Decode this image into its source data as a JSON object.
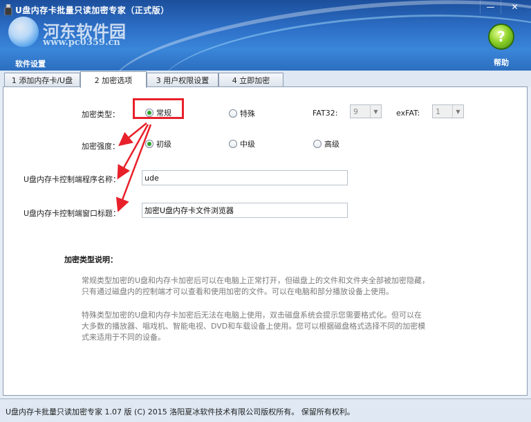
{
  "window": {
    "title": "U盘内存卡批量只读加密专家（正式版）",
    "minimize_glyph": "—",
    "close_glyph": "✕"
  },
  "watermark": {
    "text": "河东软件园",
    "url": "www.pc0359.cn"
  },
  "header": {
    "settings_label": "软件设置",
    "help_label": "帮助",
    "help_glyph": "?"
  },
  "tabs": [
    {
      "label": "1 添加内存卡/U盘"
    },
    {
      "label": "2 加密选项"
    },
    {
      "label": "3 用户权限设置"
    },
    {
      "label": "4 立即加密"
    }
  ],
  "form": {
    "encrypt_type_label": "加密类型：",
    "encrypt_type_options": [
      "常规",
      "特殊"
    ],
    "fat32_label": "FAT32:",
    "fat32_value": "9",
    "exfat_label": "exFAT:",
    "exfat_value": "1",
    "strength_label": "加密强度：",
    "strength_options": [
      "初级",
      "中级",
      "高级"
    ],
    "program_name_label": "U盘内存卡控制端程序名称：",
    "program_name_value": "ude",
    "window_title_label": "U盘内存卡控制端窗口标题：",
    "window_title_value": "加密U盘内存卡文件浏览器"
  },
  "description": {
    "title": "加密类型说明：",
    "para1_line1": "常规类型加密的U盘和内存卡加密后可以在电脑上正常打开，但磁盘上的文件和文件夹全部被加密隐藏，",
    "para1_line2": "只有通过磁盘内的控制端才可以查看和使用加密的文件。可以在电脑和部分播放设备上使用。",
    "para2_line1": "特殊类型加密的U盘和内存卡加密后无法在电脑上使用，双击磁盘系统会提示您需要格式化。但可以在",
    "para2_line2": "大多数的播放器、唱戏机、智能电视、DVD和车载设备上使用。您可以根据磁盘格式选择不同的加密模",
    "para2_line3": "式来适用于不同的设备。"
  },
  "status": {
    "text": "U盘内存卡批量只读加密专家 1.07 版  (C)  2015 洛阳夏冰软件技术有限公司版权所有。 保留所有权利。"
  },
  "colors": {
    "header_blue": "#2d6fc7",
    "annotation_red": "#e8202a",
    "radio_green": "#29a329"
  }
}
